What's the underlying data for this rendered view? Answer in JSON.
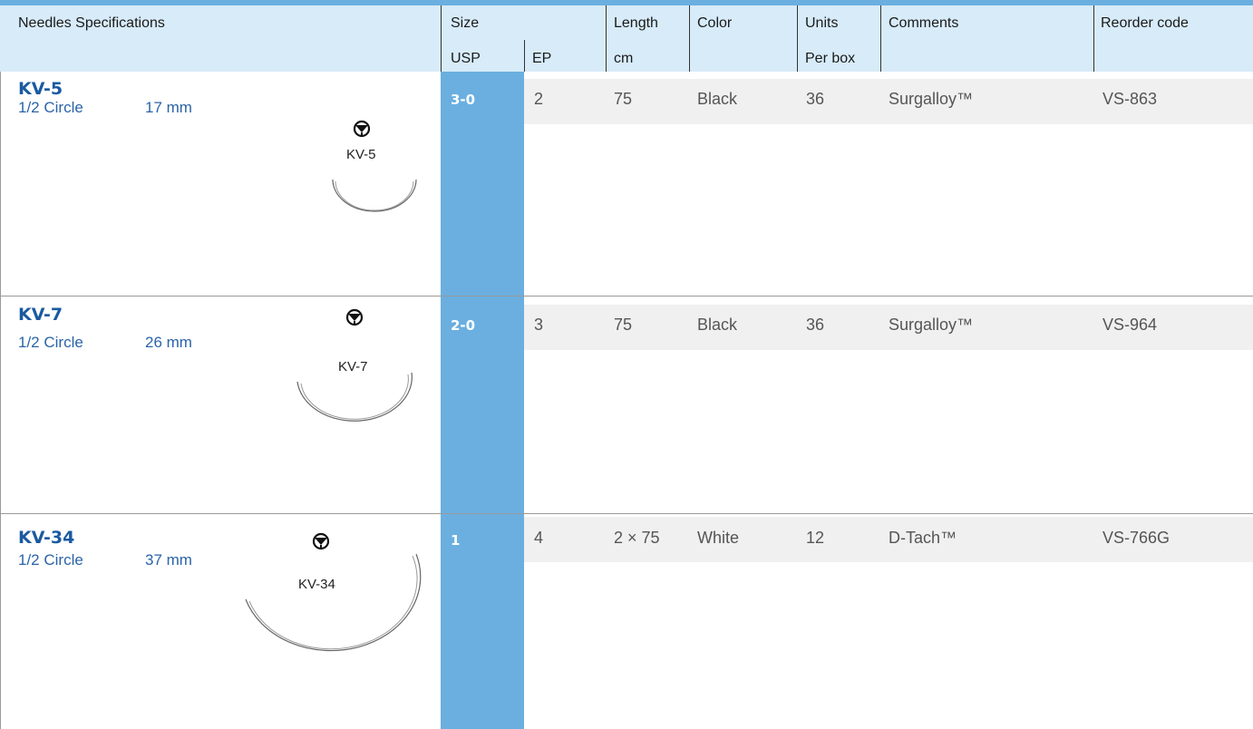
{
  "header": {
    "needles": "Needles Specifications",
    "size": "Size",
    "usp": "USP",
    "ep": "EP",
    "length": "Length",
    "length_unit": "cm",
    "color": "Color",
    "units": "Units",
    "units_sub": "Per box",
    "comments": "Comments",
    "reorder": "Reorder code"
  },
  "rows": [
    {
      "code": "KV-5",
      "shape": "1/2 Circle",
      "size_mm": "17 mm",
      "needle_label": "KV-5",
      "usp": "3-0",
      "ep": "2",
      "length": "75",
      "color": "Black",
      "units": "36",
      "comments": "Surgalloy™",
      "reorder": "VS-863"
    },
    {
      "code": "KV-7",
      "shape": "1/2 Circle",
      "size_mm": "26 mm",
      "needle_label": "KV-7",
      "usp": "2-0",
      "ep": "3",
      "length": "75",
      "color": "Black",
      "units": "36",
      "comments": "Surgalloy™",
      "reorder": "VS-964"
    },
    {
      "code": "KV-34",
      "shape": "1/2 Circle",
      "size_mm": "37 mm",
      "needle_label": "KV-34",
      "usp": "1",
      "ep": "4",
      "length": "2 × 75",
      "color": "White",
      "units": "12",
      "comments": "D-Tach™",
      "reorder": "VS-766G"
    }
  ],
  "icons": {
    "needle_symbol": "cutting-needle-icon"
  },
  "colors": {
    "accent": "#6aafe0",
    "header_bg": "#d7ebf9",
    "code_text": "#1a5aa0"
  }
}
